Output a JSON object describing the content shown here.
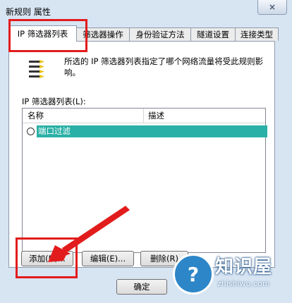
{
  "window": {
    "title": "新规则 属性",
    "close_glyph": "×"
  },
  "tabs": [
    {
      "label": "IP 筛选器列表",
      "active": true
    },
    {
      "label": "筛选器操作"
    },
    {
      "label": "身份验证方法"
    },
    {
      "label": "隧道设置"
    },
    {
      "label": "连接类型"
    }
  ],
  "description": "所选的 IP 筛选器列表指定了哪个网络流量将受此规则影响。",
  "filter_list": {
    "label": "IP 筛选器列表(L):",
    "columns": [
      "名称",
      "描述"
    ],
    "rows": [
      {
        "name": "端口过滤",
        "description": ""
      }
    ]
  },
  "buttons": {
    "add": "添加(D)...",
    "edit": "编辑(E)...",
    "delete": "删除(R)"
  },
  "footer": {
    "ok": "确定"
  },
  "watermark": {
    "text": "知识屋",
    "url": "zhishiwu.com",
    "glyph": "?"
  },
  "colors": {
    "selection": "#2ab0a6",
    "annotation": "#e21c1c"
  }
}
